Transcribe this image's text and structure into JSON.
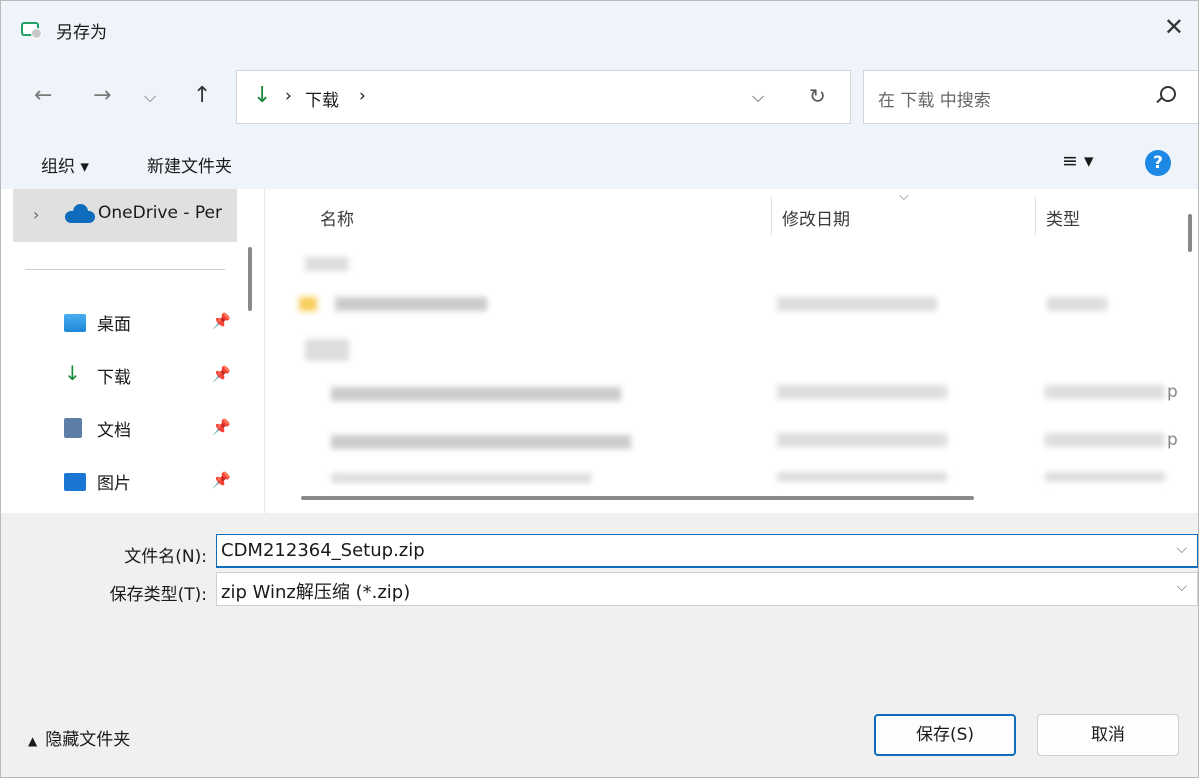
{
  "window": {
    "title": "另存为",
    "close_glyph": "✕"
  },
  "nav": {
    "back": "←",
    "forward": "→",
    "recent": "⌵",
    "up": "↑"
  },
  "address": {
    "download_icon": "download-icon",
    "breadcrumb_sep1": "›",
    "folder": "下载",
    "breadcrumb_sep2": "›",
    "dropdown_glyph": "⌵",
    "refresh_glyph": "↻"
  },
  "search": {
    "placeholder": "在 下载 中搜索"
  },
  "toolbar": {
    "organize": "组织 ▾",
    "new_folder": "新建文件夹",
    "view_glyph": "≡ ▾",
    "help": "?"
  },
  "sidebar": {
    "onedrive_label": "OneDrive - Per",
    "items": [
      {
        "label": "桌面",
        "icon": "desktop-icon"
      },
      {
        "label": "下载",
        "icon": "download-icon"
      },
      {
        "label": "文档",
        "icon": "document-icon"
      },
      {
        "label": "图片",
        "icon": "pictures-icon"
      }
    ],
    "pin_glyph": "📌"
  },
  "columns": {
    "name": "名称",
    "modified": "修改日期",
    "type": "类型",
    "sort_glyph": "⌵"
  },
  "file_list_partial": [
    "p",
    "p"
  ],
  "form": {
    "filename_label": "文件名(N):",
    "filename_value": "CDM212364_Setup.zip",
    "filetype_label": "保存类型(T):",
    "filetype_value": "zip Winz解压缩 (*.zip)",
    "dropdown_glyph": "⌵"
  },
  "footer": {
    "hide_folders": "隐藏文件夹",
    "save": "保存(S)",
    "cancel": "取消"
  }
}
